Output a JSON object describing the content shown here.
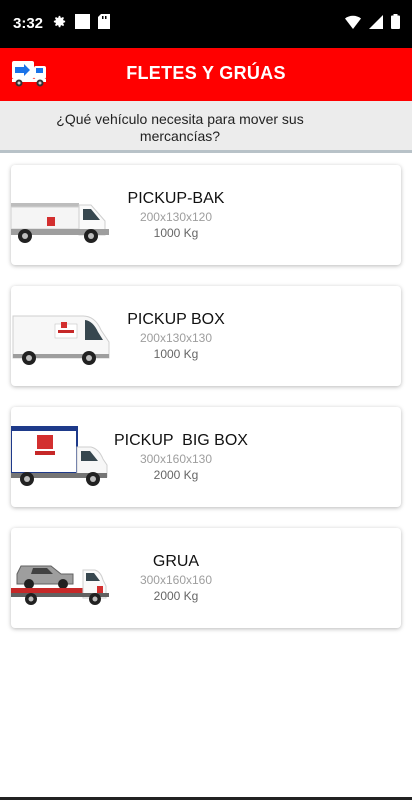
{
  "status_bar": {
    "time": "3:32",
    "left_icons": [
      "gear-icon",
      "square-icon",
      "sd-card-icon"
    ],
    "right_icons": [
      "wifi-icon",
      "signal-icon",
      "battery-icon"
    ]
  },
  "app_bar": {
    "title": "FLETES Y GRÚAS",
    "logo_icon": "truck-arrow-logo-icon",
    "color": "#ff0000"
  },
  "subheader": {
    "question": "¿Qué vehículo necesita para mover sus mercancías?"
  },
  "vehicles": [
    {
      "name": "PICKUP-BAK",
      "dimensions": "200x130x120",
      "capacity": "1000 Kg",
      "image_icon": "flatbed-van-icon"
    },
    {
      "name": "PICKUP BOX",
      "dimensions": "200x130x130",
      "capacity": "1000 Kg",
      "image_icon": "cargo-van-icon"
    },
    {
      "name": "PICKUP  BIG BOX",
      "dimensions": "300x160x130",
      "capacity": "2000 Kg",
      "image_icon": "box-truck-icon"
    },
    {
      "name": "GRUA",
      "dimensions": "300x160x160",
      "capacity": "2000 Kg",
      "image_icon": "tow-truck-icon"
    }
  ]
}
